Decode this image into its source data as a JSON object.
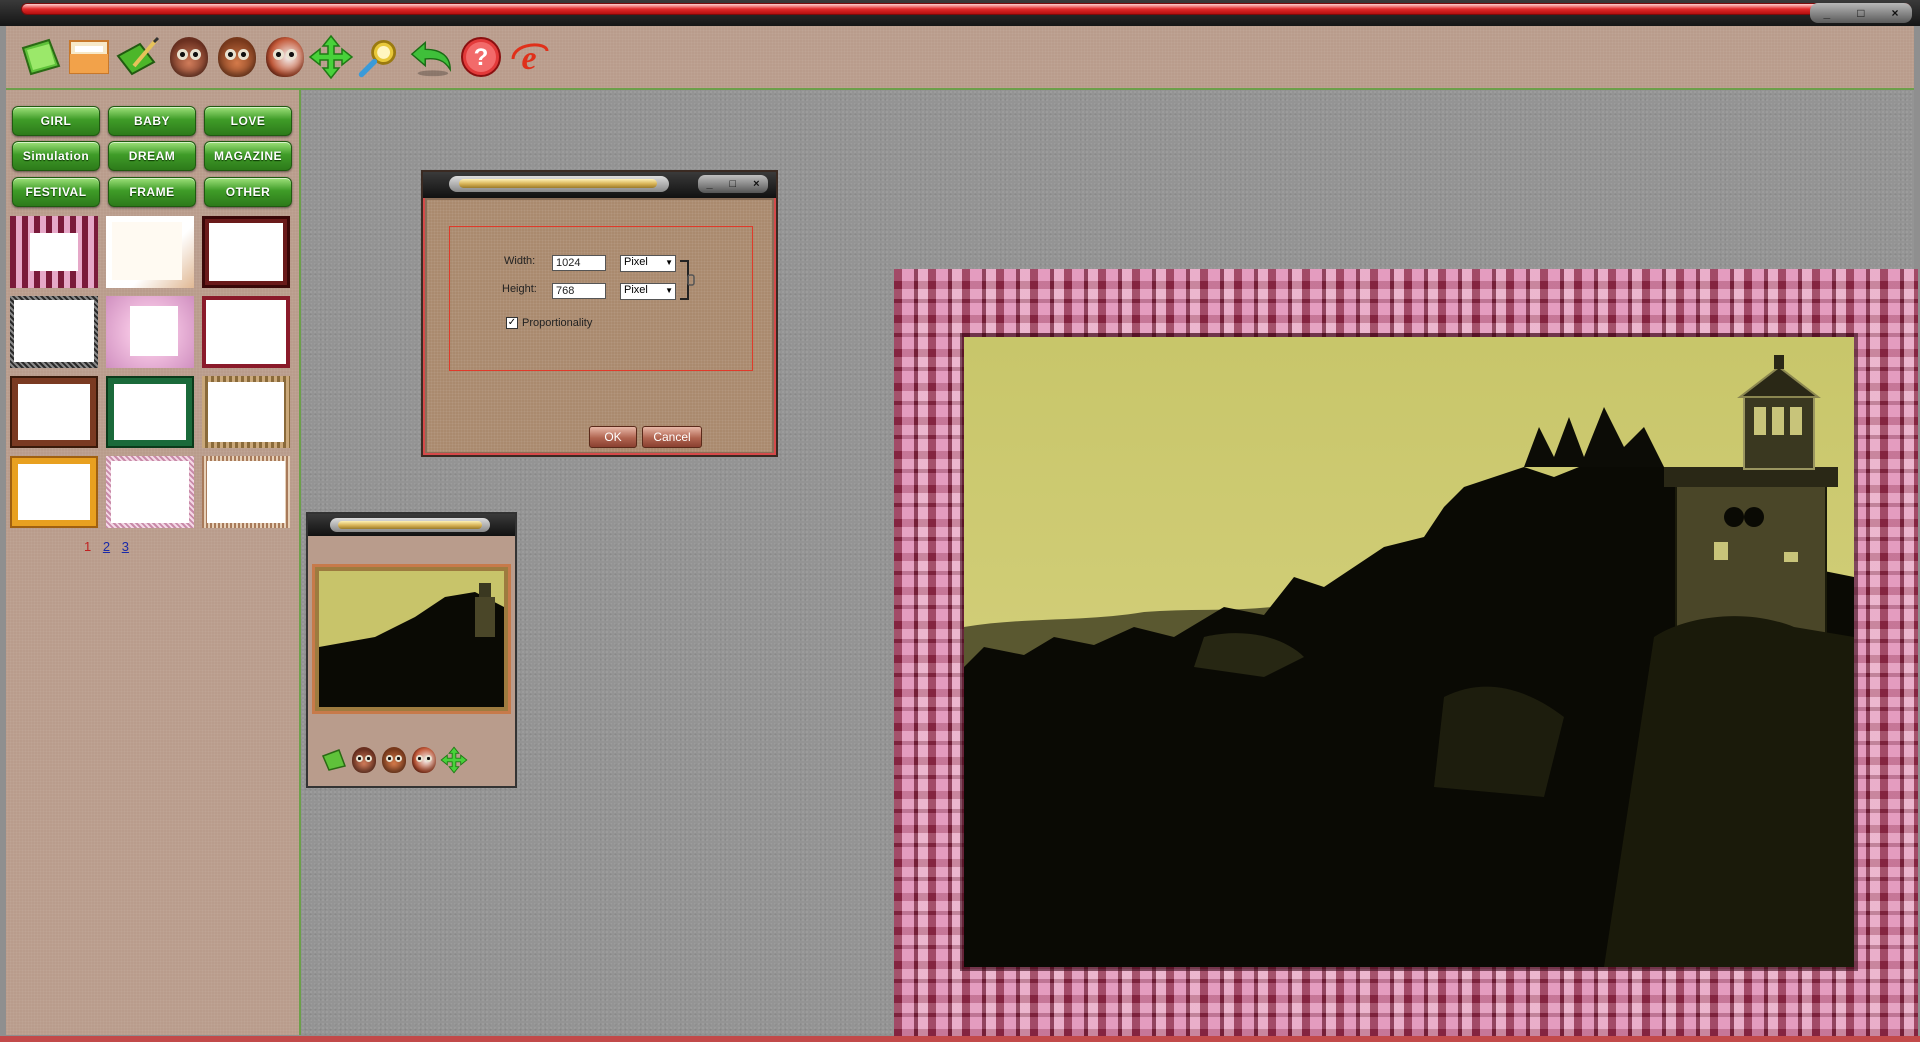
{
  "window": {
    "controls": [
      "_",
      "□",
      "×"
    ]
  },
  "toolbar": {
    "icons": [
      "open-icon",
      "image-icon",
      "edit-icon",
      "owl-effect-icon",
      "owl-effect-2-icon",
      "owl-effect-3-icon",
      "move-icon",
      "zoom-icon",
      "undo-icon",
      "help-icon",
      "internet-explorer-icon"
    ]
  },
  "sidebar": {
    "categories": [
      {
        "label": "GIRL"
      },
      {
        "label": "BABY"
      },
      {
        "label": "LOVE"
      },
      {
        "label": "Simulation"
      },
      {
        "label": "DREAM"
      },
      {
        "label": "MAGAZINE"
      },
      {
        "label": "FESTIVAL"
      },
      {
        "label": "FRAME"
      },
      {
        "label": "OTHER"
      }
    ],
    "pages": [
      "1",
      "2",
      "3"
    ],
    "current_page": "1"
  },
  "dialog": {
    "controls": [
      "_",
      "□",
      "×"
    ],
    "width_label": "Width:",
    "width_value": "1024",
    "height_label": "Height:",
    "height_value": "768",
    "width_unit": "Pixel",
    "height_unit": "Pixel",
    "proportionality_label": "Proportionality",
    "proportionality_checked": true,
    "ok_label": "OK",
    "cancel_label": "Cancel"
  },
  "colors": {
    "panel": "#b99c8c",
    "accent_green": "#3f9c28",
    "title_red": "#e22a2a",
    "workspace": "#949494",
    "photo_tint": "#c9c36a"
  }
}
